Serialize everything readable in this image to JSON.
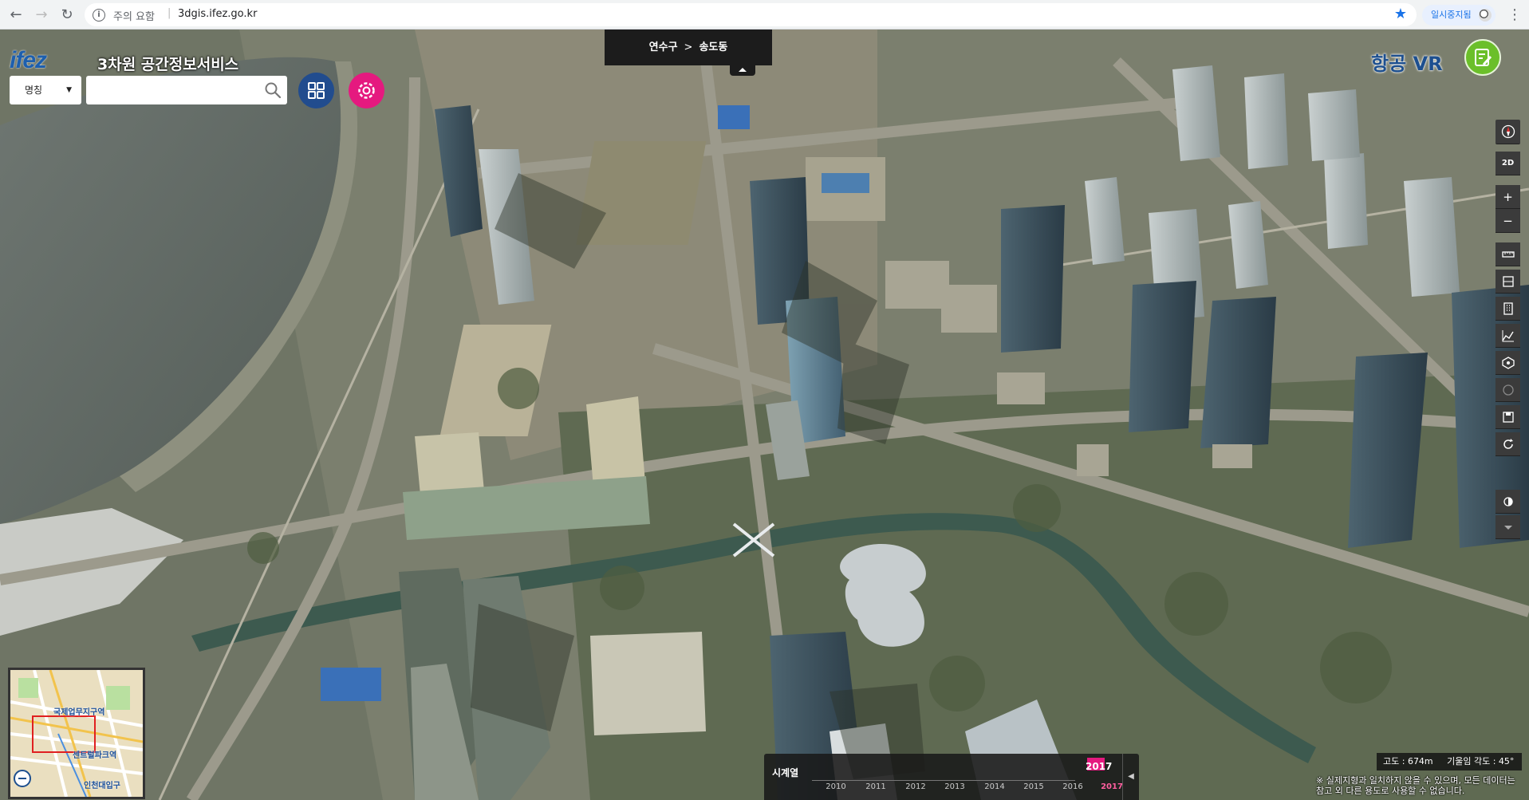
{
  "browser": {
    "warning": "주의 요함",
    "url": "3dgis.ifez.go.kr",
    "pause_chip": "일시중지됨"
  },
  "app": {
    "logo": "ifez",
    "title": "3차원 공간정보서비스"
  },
  "search": {
    "type_selected": "명칭",
    "placeholder": "",
    "value": ""
  },
  "location": {
    "district": "연수구",
    "dong": "송도동"
  },
  "topright": {
    "vr_label": "항공 VR"
  },
  "toolbar": {
    "mode_2d": "2D"
  },
  "minimap": {
    "labels": [
      "국제업무지구역",
      "센트럴파크역",
      "인천대입구"
    ]
  },
  "timeline": {
    "title": "시계열",
    "years": [
      "2010",
      "2011",
      "2012",
      "2013",
      "2014",
      "2015",
      "2016",
      "2017"
    ],
    "selected_year": "2017"
  },
  "status": {
    "altitude": "고도 : 674m",
    "tilt": "기울임 각도 : 45°",
    "disclaimer": "※ 실제지형과 일치하지 않을 수 있으며, 모든 데이터는 참고 외 다른 용도로 사용할 수 없습니다."
  },
  "colors": {
    "brand_blue": "#1d4f8f",
    "accent_pink": "#e5197f",
    "accent_green": "#6bbf2a"
  }
}
